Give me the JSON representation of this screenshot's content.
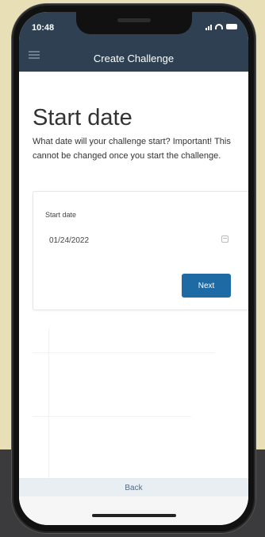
{
  "status_bar": {
    "time": "10:48"
  },
  "header": {
    "title": "Create Challenge"
  },
  "page": {
    "title": "Start date",
    "description": "What date will your challenge start? Important! This cannot be changed once you start the challenge."
  },
  "form": {
    "field_label": "Start date",
    "date_value": "01/24/2022",
    "next_label": "Next"
  },
  "footer": {
    "back_label": "Back"
  },
  "icons": {
    "menu": "hamburger-icon",
    "calendar": "calendar-icon",
    "signal": "signal-icon",
    "wifi": "wifi-icon",
    "battery": "battery-icon"
  },
  "colors": {
    "header_bg": "#2e4052",
    "primary_button": "#1e6aa5",
    "backdrop": "#e9dfb6"
  }
}
